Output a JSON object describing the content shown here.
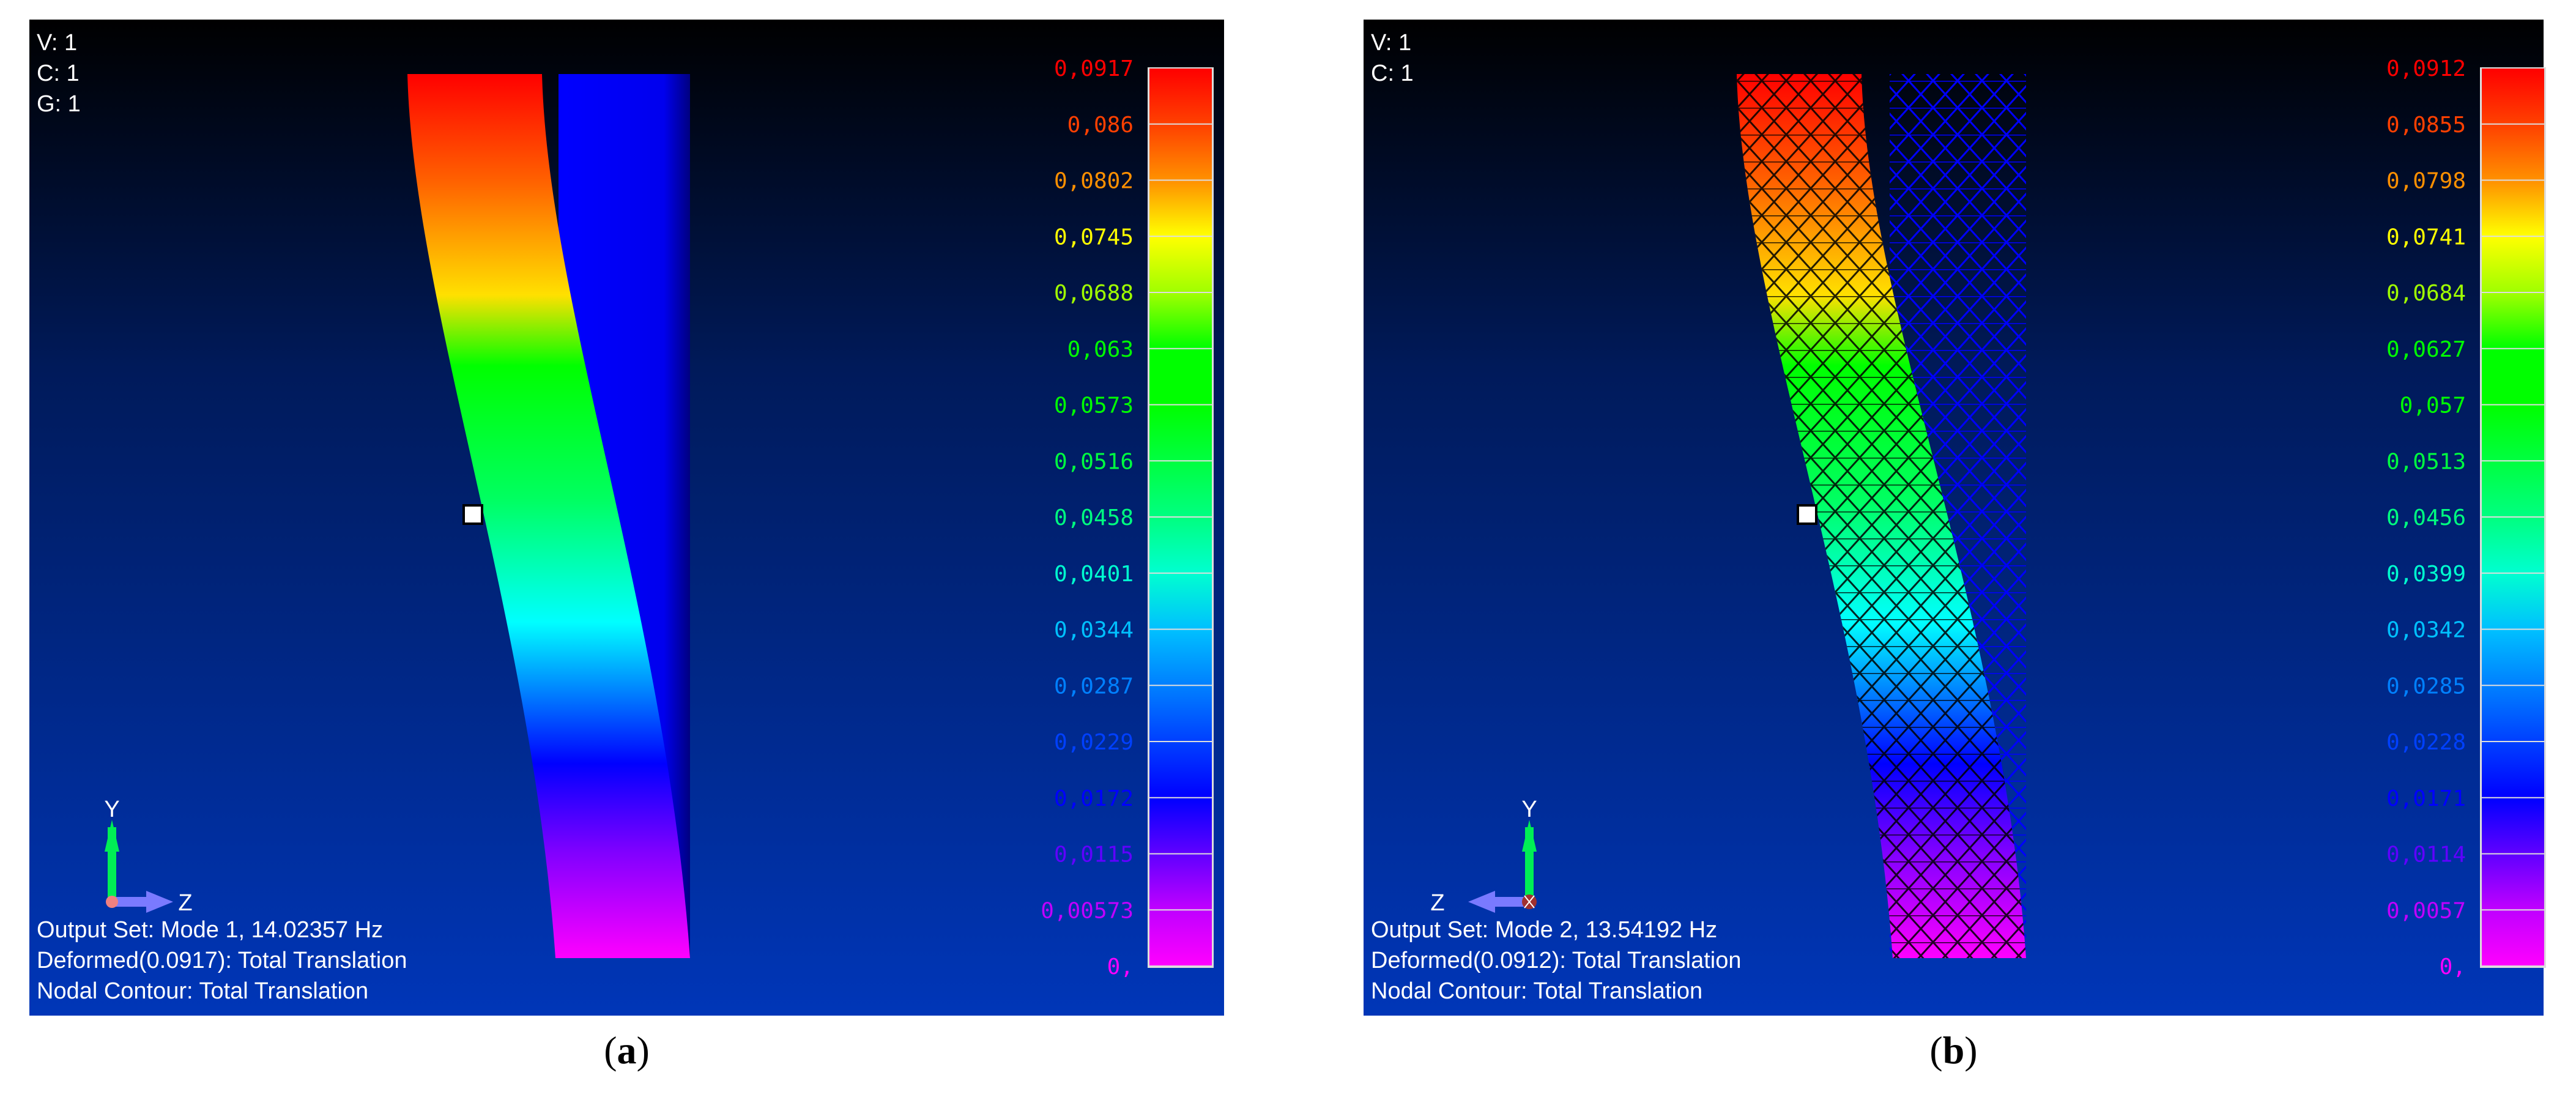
{
  "panels": [
    {
      "id": "a",
      "caption_open": "(",
      "caption_letter": "a",
      "caption_close": ")",
      "corner_info": [
        "V: 1",
        "C: 1",
        "G: 1"
      ],
      "axis_labels": {
        "y": "Y",
        "z": "Z"
      },
      "status_lines": [
        "Output Set: Mode 1, 14.02357 Hz",
        "Deformed(0.0917): Total Translation",
        "Nodal Contour: Total Translation"
      ],
      "legend_values": [
        "0,0917",
        "0,086",
        "0,0802",
        "0,0745",
        "0,0688",
        "0,063",
        "0,0573",
        "0,0516",
        "0,0458",
        "0,0401",
        "0,0344",
        "0,0287",
        "0,0229",
        "0,0172",
        "0,0115",
        "0,00573",
        "0,"
      ],
      "render_style": "solid"
    },
    {
      "id": "b",
      "caption_open": "(",
      "caption_letter": "b",
      "caption_close": ")",
      "corner_info": [
        "V: 1",
        "C: 1"
      ],
      "axis_labels": {
        "y": "Y",
        "z": "Z"
      },
      "status_lines": [
        "Output Set: Mode 2, 13.54192 Hz",
        "Deformed(0.0912): Total Translation",
        "Nodal Contour: Total Translation"
      ],
      "legend_values": [
        "0,0912",
        "0,0855",
        "0,0798",
        "0,0741",
        "0,0684",
        "0,0627",
        "0,057",
        "0,0513",
        "0,0456",
        "0,0399",
        "0,0342",
        "0,0285",
        "0,0228",
        "0,0171",
        "0,0114",
        "0,0057",
        "0,"
      ],
      "render_style": "wireframe"
    }
  ],
  "legend_colors": [
    "#ff0000",
    "#ff4000",
    "#ff9000",
    "#ffff00",
    "#a0ff00",
    "#00ff00",
    "#00ff00",
    "#00ff40",
    "#00ff80",
    "#00ffd0",
    "#00c0ff",
    "#0080ff",
    "#0040ff",
    "#0000ff",
    "#6000ff",
    "#c000ff",
    "#ff00ff"
  ]
}
